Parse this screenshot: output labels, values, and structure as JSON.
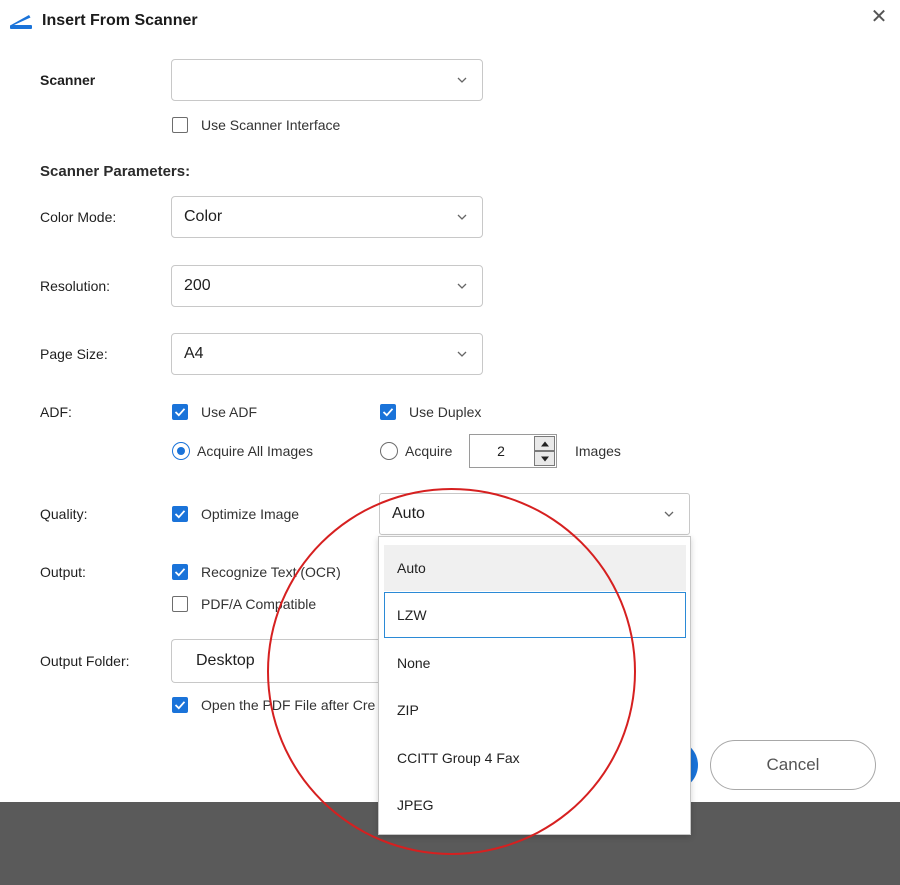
{
  "window": {
    "title": "Insert From Scanner",
    "close_glyph": "✕"
  },
  "scanner": {
    "label": "Scanner",
    "value": "",
    "use_interface_label": "Use Scanner Interface",
    "use_interface_checked": false
  },
  "params": {
    "section_title": "Scanner Parameters:",
    "color_mode": {
      "label": "Color Mode:",
      "value": "Color"
    },
    "resolution": {
      "label": "Resolution:",
      "value": "200"
    },
    "page_size": {
      "label": "Page Size:",
      "value": "A4"
    }
  },
  "adf": {
    "label": "ADF:",
    "use_adf": {
      "label": "Use ADF",
      "checked": true
    },
    "use_duplex": {
      "label": "Use Duplex",
      "checked": true
    },
    "acquire_all": {
      "label": "Acquire All Images",
      "selected": true
    },
    "acquire_n": {
      "label": "Acquire",
      "value": "2",
      "suffix": "Images",
      "selected": false
    }
  },
  "quality": {
    "label": "Quality:",
    "optimize": {
      "label": "Optimize Image",
      "checked": true
    },
    "compression_value": "Auto"
  },
  "output": {
    "label": "Output:",
    "ocr": {
      "label": "Recognize Text (OCR)",
      "checked": true
    },
    "pdfa": {
      "label": "PDF/A Compatible",
      "checked": false
    }
  },
  "output_folder": {
    "label": "Output Folder:",
    "value": "Desktop",
    "open_after": {
      "label": "Open the PDF File after Cre",
      "checked": true
    }
  },
  "buttons": {
    "cancel": "Cancel"
  },
  "dropdown": {
    "options": [
      "Auto",
      "LZW",
      "None",
      "ZIP",
      "CCITT Group 4 Fax",
      "JPEG"
    ],
    "hovered": "Auto",
    "focused": "LZW"
  },
  "colors": {
    "accent": "#1a73d9",
    "annotation": "#d62020",
    "backdrop": "#5a5a5a"
  }
}
